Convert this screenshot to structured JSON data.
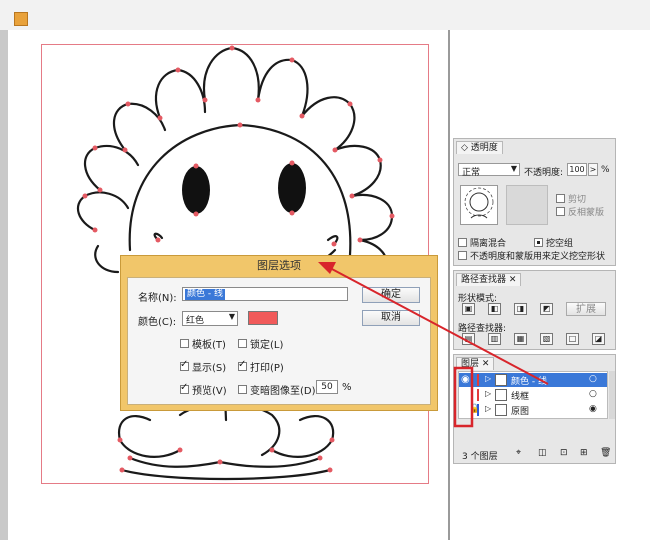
{
  "canvas": {
    "artwork": "sunflower-outline"
  },
  "dialog": {
    "title": "图层选项",
    "name_label": "名称(N):",
    "name_value": "颜色 - 线",
    "ok_label": "确定",
    "color_label": "颜色(C):",
    "color_value": "红色",
    "color_swatch": "#f15a5a",
    "cancel_label": "取消",
    "options": [
      {
        "label": "模板(T)",
        "checked": false
      },
      {
        "label": "锁定(L)",
        "checked": false
      },
      {
        "label": "显示(S)",
        "checked": true
      },
      {
        "label": "打印(P)",
        "checked": true
      },
      {
        "label": "预览(V)",
        "checked": true
      },
      {
        "label": "变暗图像至(D):",
        "checked": false
      }
    ],
    "dim_value": "50",
    "dim_unit": "%"
  },
  "transparency_panel": {
    "tab_label": "透明度",
    "blend_mode": "正常",
    "opacity_label": "不透明度:",
    "opacity_value": "100",
    "opacity_unit": "%",
    "clip_label": "剪切",
    "invert_mask_label": "反相蒙版",
    "isolate_label": "隔离混合",
    "knockout_label": "挖空组",
    "opacity_mask_label": "不透明度和蒙版用来定义挖空形状"
  },
  "pathfinder_panel": {
    "tab_label": "路径查找器",
    "shape_modes_label": "形状模式:",
    "expand_label": "扩展",
    "pathfinders_label": "路径查找器:"
  },
  "layers_panel": {
    "tab_label": "图层",
    "layers": [
      {
        "name": "颜色 - 线",
        "color": "#e23b3b",
        "selected": true
      },
      {
        "name": "线框",
        "color": "#e23b3b",
        "selected": false
      },
      {
        "name": "原图",
        "color": "#2c56d6",
        "selected": false
      }
    ],
    "count_label": "3 个图层"
  },
  "colors": {
    "dialog_frame": "#f1c66a",
    "selection_blue": "#3a78d8",
    "annotation_red": "#d8252b"
  }
}
